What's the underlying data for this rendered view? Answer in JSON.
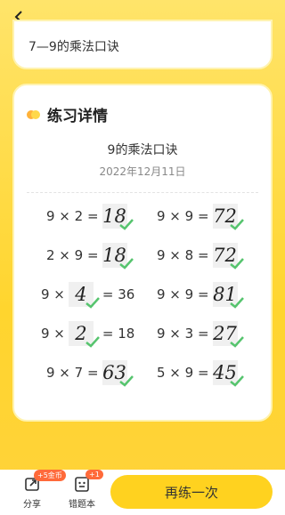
{
  "top": {
    "back_icon": "back-arrow-icon",
    "card_title": "7—9的乘法口诀"
  },
  "details": {
    "section_title": "练习详情",
    "practice_title": "9的乘法口诀",
    "date": "2022年12月11日",
    "check_color": "#56c46e",
    "equations": [
      {
        "pre": "9 × 2 =",
        "ans": "18",
        "post": ""
      },
      {
        "pre": "9 × 9 =",
        "ans": "72",
        "post": ""
      },
      {
        "pre": "2 × 9 =",
        "ans": "18",
        "post": ""
      },
      {
        "pre": "9 × 8 =",
        "ans": "72",
        "post": ""
      },
      {
        "pre": "9 ×",
        "ans": "4",
        "post": "= 36"
      },
      {
        "pre": "9 × 9 =",
        "ans": "81",
        "post": ""
      },
      {
        "pre": "9 ×",
        "ans": "2",
        "post": "= 18"
      },
      {
        "pre": "9 × 3 =",
        "ans": "27",
        "post": ""
      },
      {
        "pre": "9 × 7 =",
        "ans": "63",
        "post": ""
      },
      {
        "pre": "5 × 9 =",
        "ans": "45",
        "post": ""
      }
    ]
  },
  "bottom": {
    "share_label": "分享",
    "share_badge": "+5金币",
    "wrong_label": "错题本",
    "wrong_badge": "+1",
    "retry_label": "再练一次"
  }
}
